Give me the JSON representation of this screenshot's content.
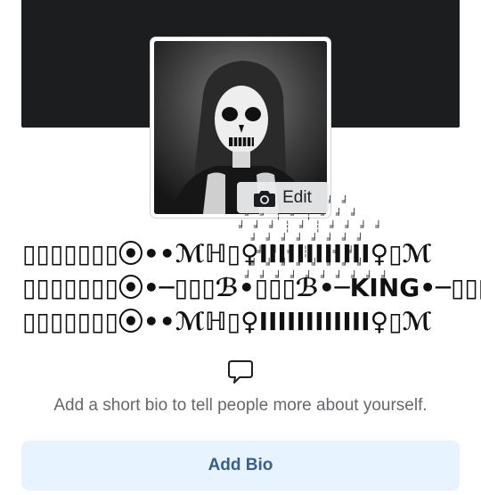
{
  "profile": {
    "edit_label": "Edit",
    "camera_icon": "camera-icon",
    "name_lines": [
      "▯▯▯▯▯▯▯⦿••ℳℍ▯♀ⅠⅠⅠⅠⅠⅠⅠⅠⅠⅠⅠⅠ♀▯ℳ",
      "▯▯▯▯▯▯▯⦿•─▯▯▯ℬ•▯▯▯ℬ•─KING•─▯▯▯ℬ•",
      "▯▯▯▯▯▯▯⦿••ℳℍ▯♀ⅠⅠⅠⅠⅠⅠⅠⅠⅠⅠⅠⅠ♀▯ℳ"
    ]
  },
  "bio": {
    "icon": "speech-bubble-icon",
    "prompt": "Add a short bio to tell people more about yourself.",
    "button_label": "Add Bio"
  },
  "colors": {
    "cover": "#1c1d1f",
    "button_bg": "#e7f3ff",
    "button_text": "#3b5f8a",
    "muted_text": "#65676b"
  }
}
